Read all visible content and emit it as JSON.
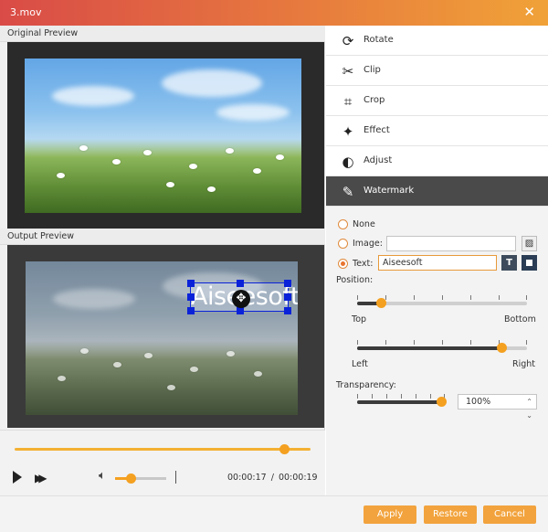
{
  "window": {
    "title": "3.mov",
    "close_icon": "close-icon"
  },
  "preview": {
    "original_label": "Original Preview",
    "output_label": "Output Preview",
    "watermark_text": "Aiseesoft"
  },
  "player": {
    "progress": 0.91,
    "volume": 0.3,
    "current_time": "00:00:17",
    "separator": "/",
    "total_time": "00:00:19"
  },
  "menu": {
    "items": [
      {
        "label": "Rotate",
        "icon": "rotate-icon"
      },
      {
        "label": "Clip",
        "icon": "scissors-icon"
      },
      {
        "label": "Crop",
        "icon": "crop-icon"
      },
      {
        "label": "Effect",
        "icon": "effect-icon"
      },
      {
        "label": "Adjust",
        "icon": "adjust-icon"
      },
      {
        "label": "Watermark",
        "icon": "brush-icon",
        "active": true
      }
    ]
  },
  "watermark": {
    "none_label": "None",
    "image_label": "Image:",
    "image_value": "",
    "text_label": "Text:",
    "text_value": "Aiseesoft",
    "selected": "text",
    "position_label": "Position:",
    "vertical": {
      "min_label": "Top",
      "max_label": "Bottom",
      "value": 0.14
    },
    "horizontal": {
      "min_label": "Left",
      "max_label": "Right",
      "value": 0.85
    },
    "transparency_label": "Transparency:",
    "transparency_slider": 0.96,
    "transparency_value": "100%"
  },
  "footer": {
    "apply": "Apply",
    "restore": "Restore",
    "cancel": "Cancel"
  },
  "colors": {
    "accent": "#f4a020",
    "title_gradient_start": "#d94b47",
    "title_gradient_end": "#f0a238",
    "selection": "#0a22d8"
  }
}
